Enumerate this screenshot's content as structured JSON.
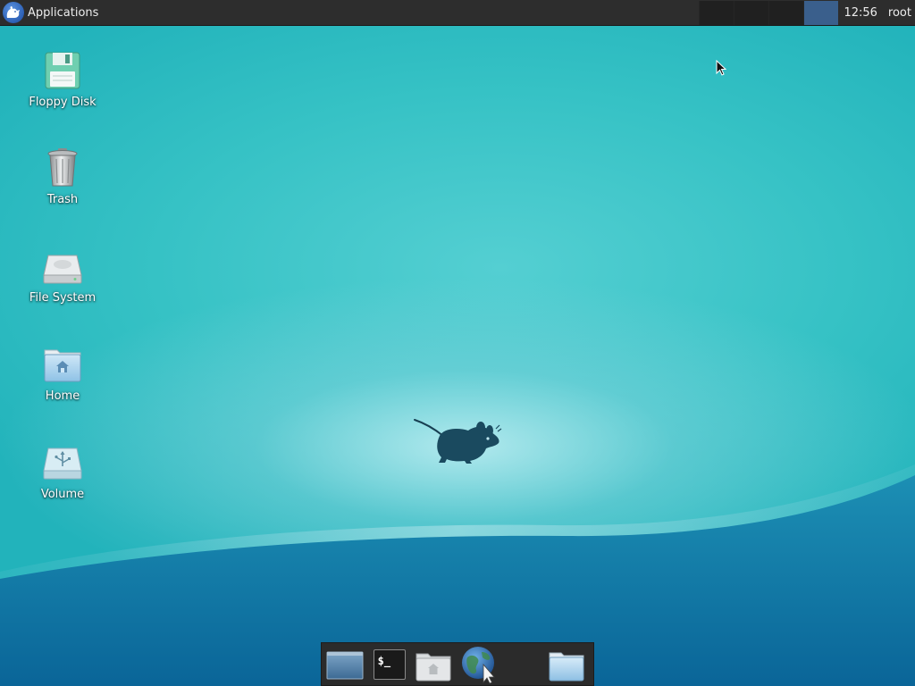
{
  "top_panel": {
    "applications_label": "Applications",
    "clock": "12:56",
    "user": "root",
    "workspaces": 4,
    "active_workspace": 4
  },
  "desktop": {
    "icons": [
      {
        "label": "Floppy Disk",
        "icon": "floppy-disk-icon"
      },
      {
        "label": "Trash",
        "icon": "trash-icon"
      },
      {
        "label": "File System",
        "icon": "hard-drive-icon"
      },
      {
        "label": "Home",
        "icon": "home-folder-icon"
      },
      {
        "label": "Volume",
        "icon": "usb-volume-icon"
      }
    ]
  },
  "dock": {
    "items": [
      {
        "icon": "show-desktop-icon"
      },
      {
        "icon": "terminal-icon",
        "glyph_text": "$_"
      },
      {
        "icon": "file-manager-icon"
      },
      {
        "icon": "web-browser-icon"
      },
      {
        "icon": "folder-icon"
      }
    ]
  },
  "colors": {
    "panel": "#2d2d2d",
    "wallpaper_top": "#22b3bb",
    "wallpaper_bottom": "#0f6f9e",
    "active_workspace": "#3a5f8c"
  }
}
